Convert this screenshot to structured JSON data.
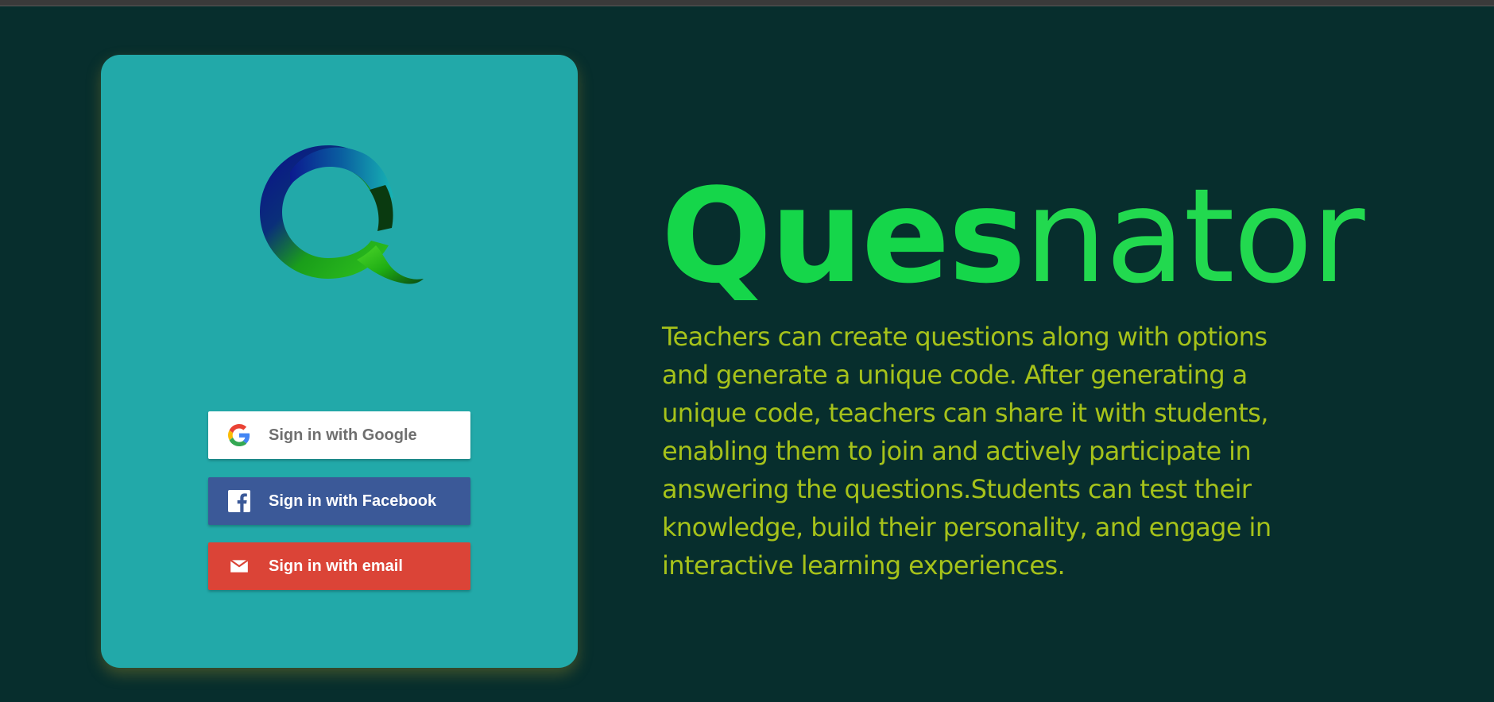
{
  "app": {
    "title_bold": "Ques",
    "title_light": "nator",
    "description": "Teachers can create questions along with options and generate a unique code. After generating a unique code, teachers can share it with students, enabling them to join and actively participate in answering the questions.Students can test their knowledge, build their personality, and engage in interactive learning experiences."
  },
  "login": {
    "google_label": "Sign in with Google",
    "facebook_label": "Sign in with Facebook",
    "email_label": "Sign in with email"
  },
  "colors": {
    "background": "#072e2d",
    "card": "#22a9a9",
    "title": "#15d64a",
    "description": "#a6c21a",
    "google_button": "#ffffff",
    "facebook_button": "#3b5998",
    "email_button": "#db4437"
  },
  "icons": {
    "logo": "quesnator-logo",
    "google": "google-g-icon",
    "facebook": "facebook-f-icon",
    "email": "envelope-icon"
  }
}
